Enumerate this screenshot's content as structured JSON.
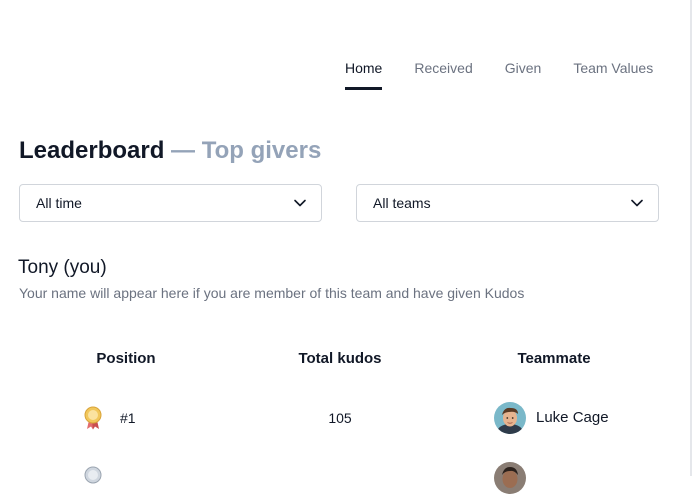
{
  "nav": {
    "tabs": [
      {
        "label": "Home",
        "active": true
      },
      {
        "label": "Received",
        "active": false
      },
      {
        "label": "Given",
        "active": false
      },
      {
        "label": "Team Values",
        "active": false
      }
    ]
  },
  "heading": {
    "title": "Leaderboard",
    "subtitle": "— Top givers"
  },
  "filters": {
    "time": {
      "value": "All time",
      "icon": "chevron-down-icon"
    },
    "team": {
      "value": "All teams",
      "icon": "chevron-down-icon"
    }
  },
  "you": {
    "name": "Tony (you)",
    "note": "Your name will appear here if you are member of this team and have given Kudos"
  },
  "table": {
    "headers": {
      "position": "Position",
      "kudos": "Total kudos",
      "teammate": "Teammate"
    },
    "rows": [
      {
        "rank": "#1",
        "kudos": "105",
        "teammate": "Luke Cage",
        "medal": "gold-medal-icon"
      },
      {
        "rank": "",
        "kudos": "",
        "teammate": "",
        "medal": "silver-medal-icon"
      }
    ]
  },
  "colors": {
    "text": "#111827",
    "muted": "#6b7280",
    "subtitle": "#94a3b8",
    "border": "#d1d5db",
    "gold": "#e8b84a",
    "ribbon": "#e26d6d"
  }
}
